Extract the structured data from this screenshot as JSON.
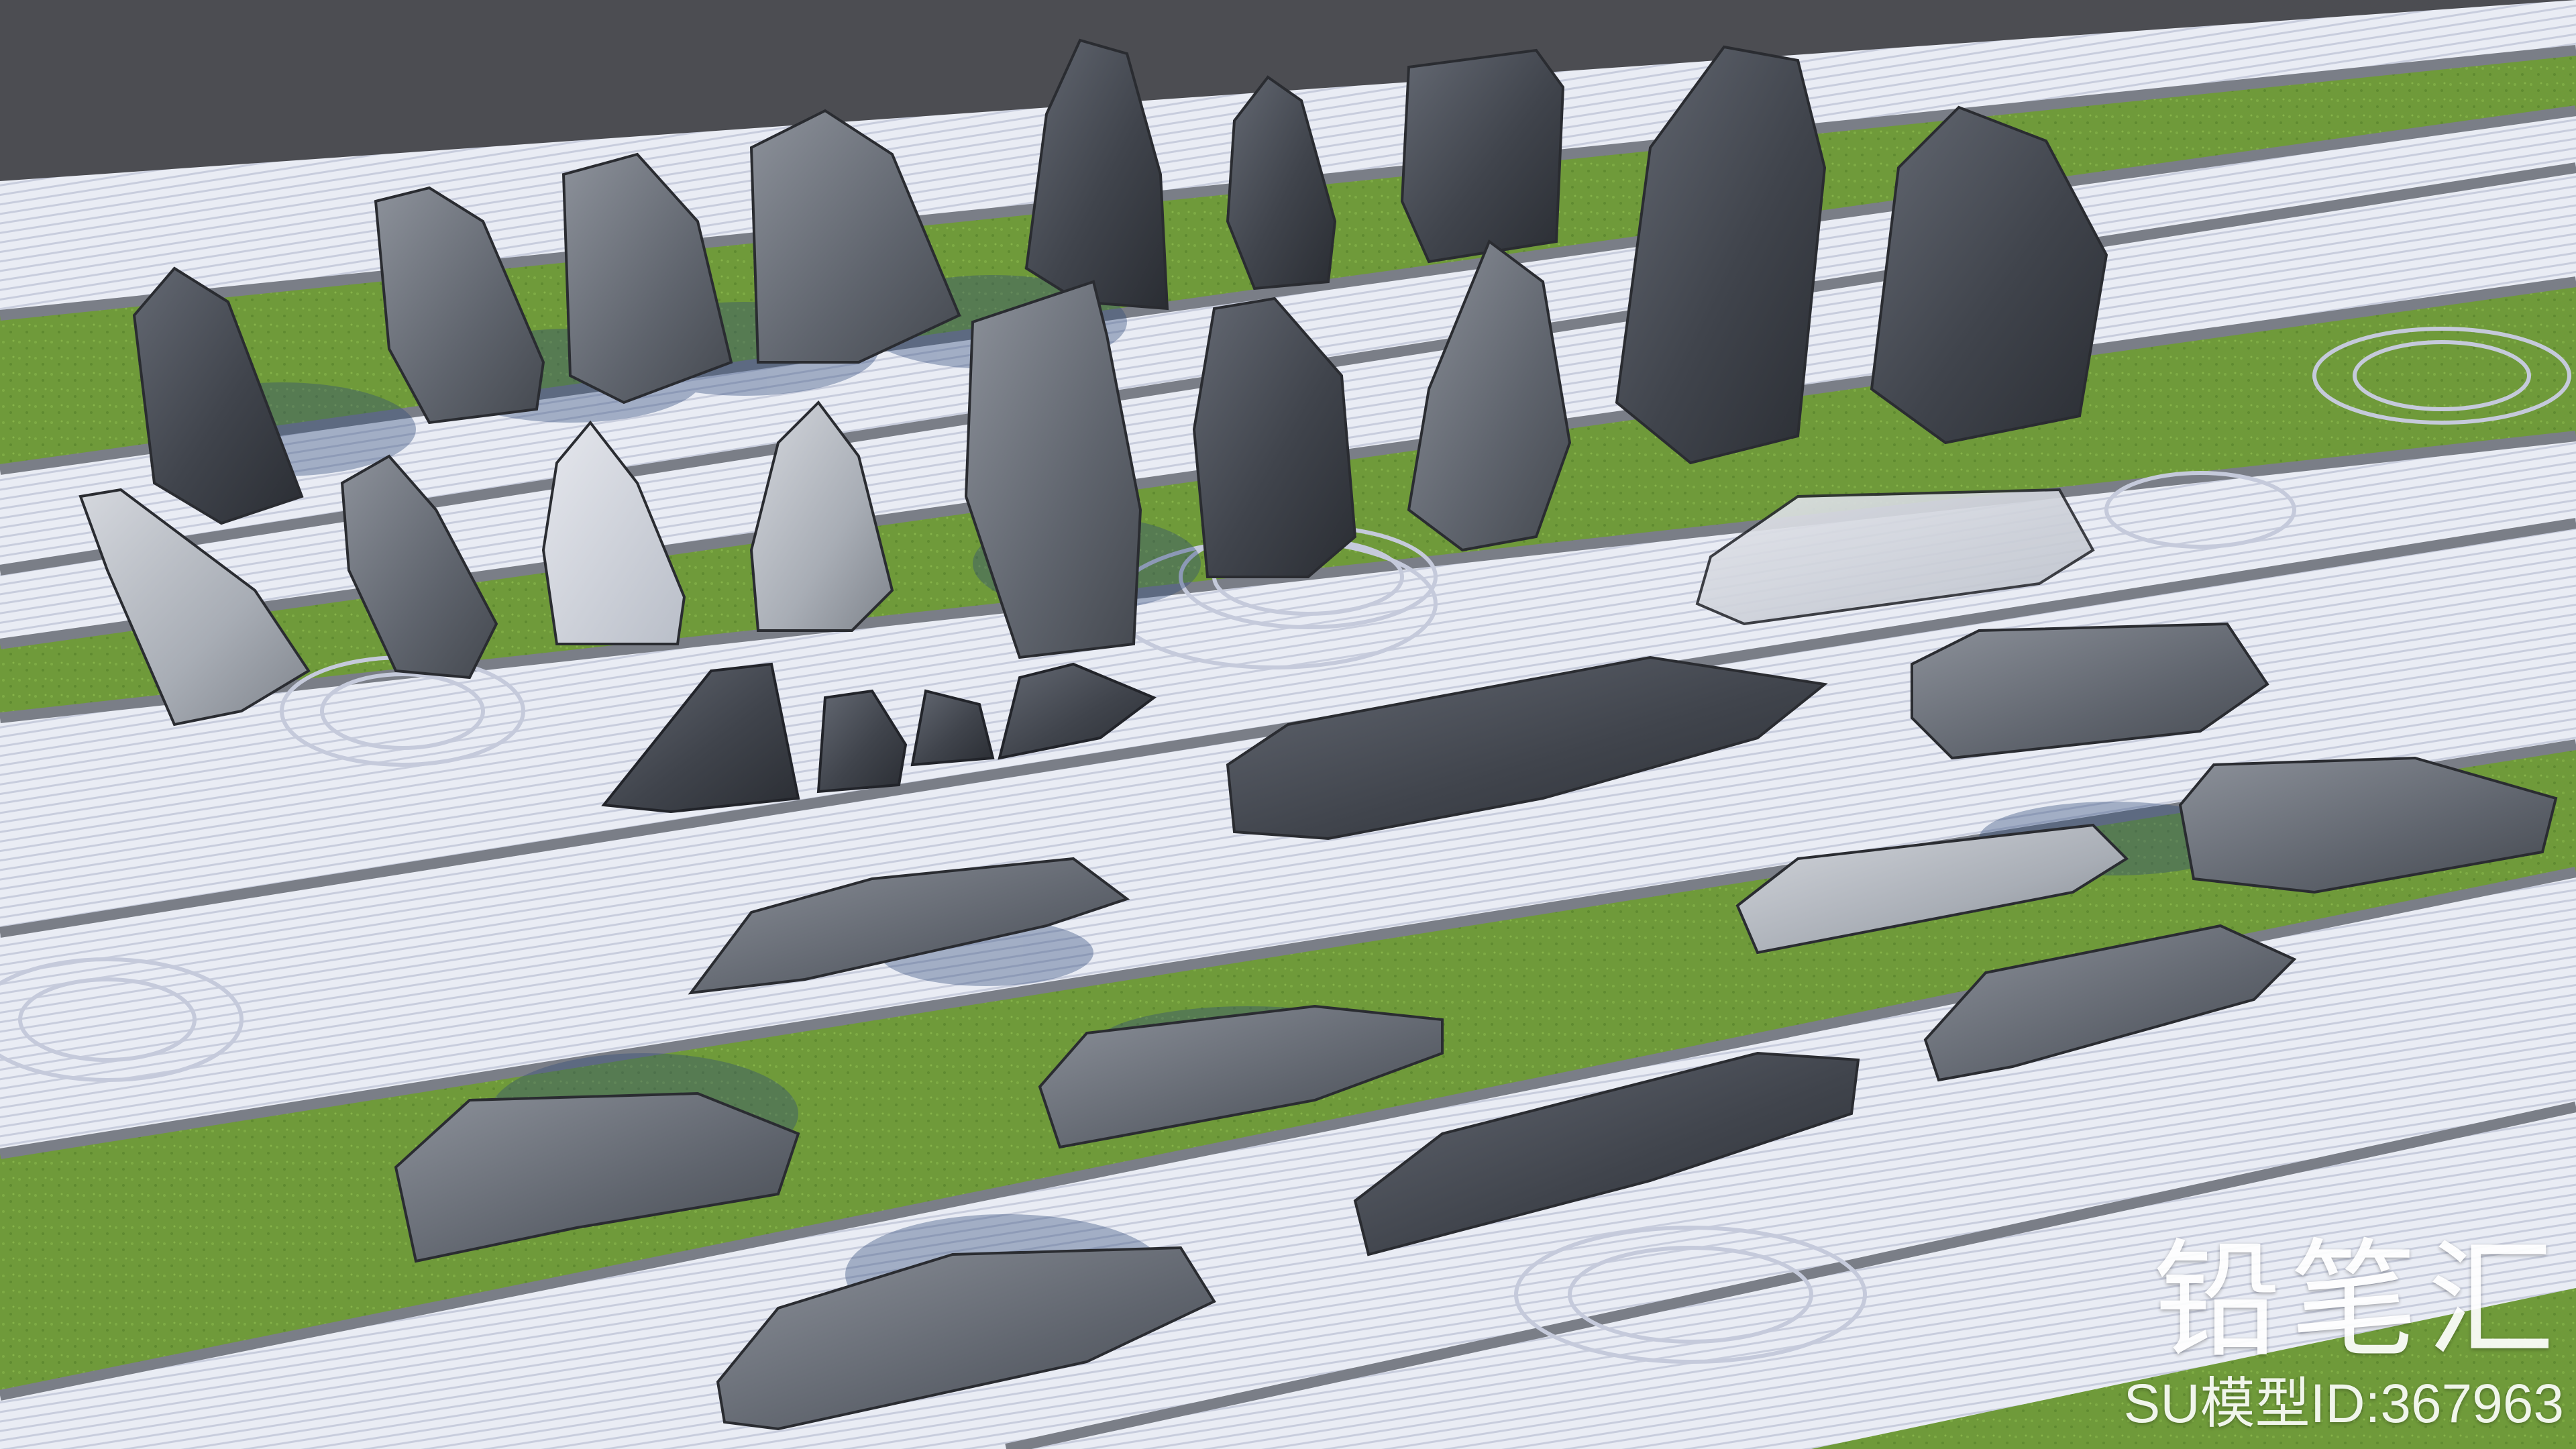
{
  "image": {
    "subject": "",
    "colors": {
      "background_top": "#4c4d52",
      "gravel": "#e8ebf3",
      "gravel_shadow": "#c9cede",
      "grass": "#6f9a3a",
      "grass_dark": "#557a2a",
      "curb": "#7b7f88",
      "stone_dark": "#3c3f47",
      "stone_mid": "#5d626c",
      "stone_light": "#a4a9b2"
    }
  },
  "watermark": {
    "title": "铅笔汇",
    "model_id": "SU模型ID:367963"
  }
}
